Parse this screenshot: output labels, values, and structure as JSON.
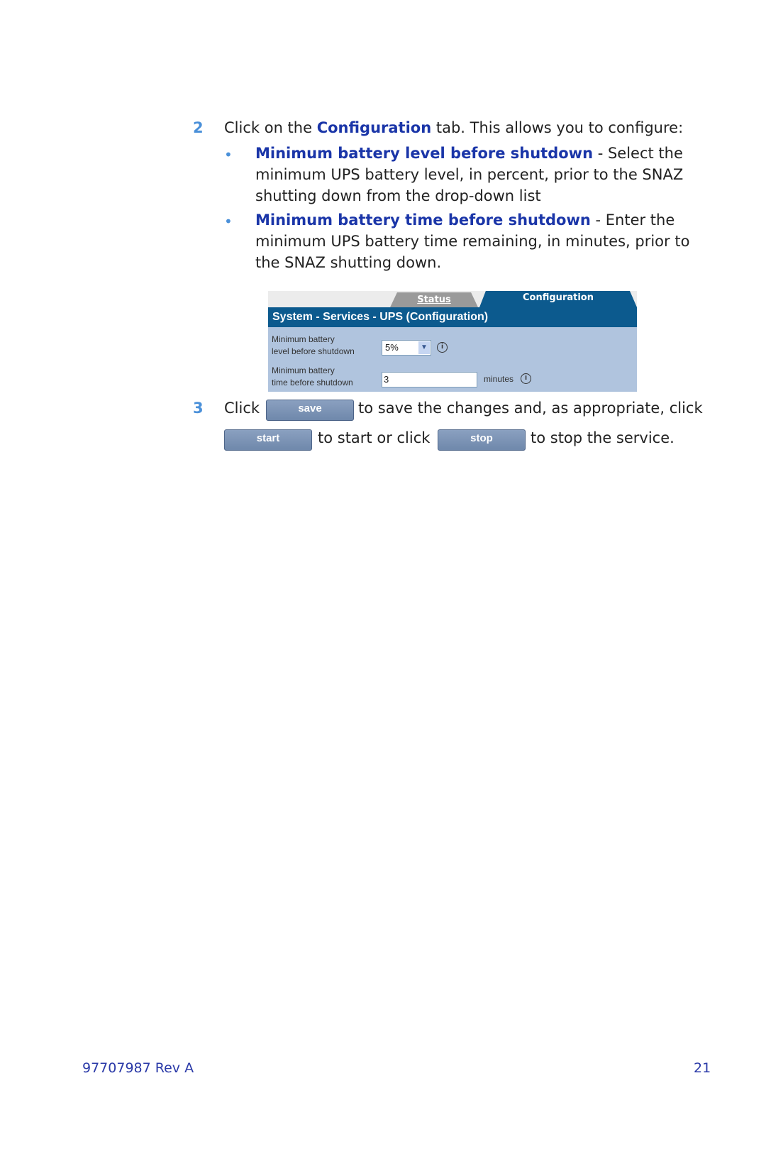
{
  "step2": {
    "number": "2",
    "intro_pre": "Click on the ",
    "intro_link": "Configuration",
    "intro_post": " tab. This allows you to configure:",
    "bullets": [
      {
        "term": "Minimum battery level before shutdown",
        "desc_line1": " - Select the",
        "desc_line2": "minimum UPS battery level, in percent, prior to the SNAZ",
        "desc_line3": "shutting down from the drop-down list"
      },
      {
        "term": "Minimum battery time before shutdown",
        "desc_line1": " - Enter the",
        "desc_line2": "minimum UPS battery time remaining, in minutes, prior to",
        "desc_line3": "the SNAZ shutting down."
      }
    ]
  },
  "panel": {
    "tabs": [
      "Status",
      "Configuration"
    ],
    "active_tab": "Configuration",
    "title": "System - Services - UPS (Configuration)",
    "fields": [
      {
        "label_line1": "Minimum battery",
        "label_line2": "level before shutdown",
        "value": "5%",
        "type": "select"
      },
      {
        "label_line1": "Minimum battery",
        "label_line2": "time before shutdown",
        "value": "3",
        "units": "minutes",
        "type": "text"
      }
    ],
    "info_glyph": "i"
  },
  "step3": {
    "number": "3",
    "click": "Click",
    "save_label": "save",
    "after_save": "to save the changes and, as appropriate, click",
    "start_label": "start",
    "after_start": "to start or click",
    "stop_label": "stop",
    "after_stop": "to stop the service."
  },
  "footer": {
    "doc_id": "97707987 Rev A",
    "page_number": "21"
  },
  "colors": {
    "step_number": "#4a90d9",
    "term": "#1a35a8",
    "panel_bg": "#b0c4de",
    "panel_header": "#0c5a8e"
  }
}
